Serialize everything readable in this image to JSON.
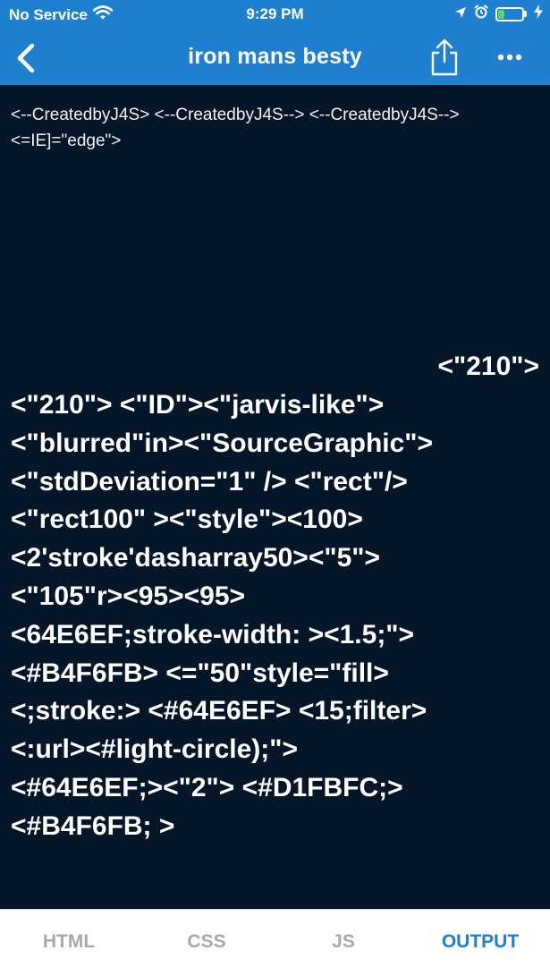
{
  "status_bar": {
    "carrier": "No Service",
    "time": "9:29 PM",
    "battery_level": 0.25,
    "battery_color": "#4cd964"
  },
  "nav": {
    "title": "iron mans besty",
    "back_icon": "chevron-left-icon",
    "share_icon": "share-icon",
    "more_icon": "ellipsis-icon"
  },
  "output": {
    "small_text": "<--CreatedbyJ4S> <--CreatedbyJ4S--> <--CreatedbyJ4S--> <=IE]=\"edge\">",
    "big_right": "<\"210\">",
    "big_lines": [
      "<\"210\"> <\"ID\"><\"jarvis-like\">",
      "<\"blurred\"in><\"SourceGraphic\">",
      "<\"stdDeviation=\"1\" /> <\"rect\"/>",
      "<\"rect100\" ><\"style\"><100>",
      "<2'stroke'dasharray50><\"5\">",
      "<\"105\"r><95><95>",
      "<64E6EF;stroke-width: ><1.5;\">",
      "<#B4F6FB> <=\"50\"style=\"fill>",
      "<;stroke:> <#64E6EF> <15;filter>",
      "<:url><#light-circle);\">",
      "<#64E6EF;><\"2\"> <#D1FBFC;>",
      "<#B4F6FB; >"
    ]
  },
  "tabs": [
    {
      "label": "HTML",
      "active": false
    },
    {
      "label": "CSS",
      "active": false
    },
    {
      "label": "JS",
      "active": false
    },
    {
      "label": "OUTPUT",
      "active": true
    }
  ],
  "colors": {
    "accent": "#1f80cf",
    "output_bg": "#041628",
    "inactive_tab": "#a9a9a9"
  }
}
